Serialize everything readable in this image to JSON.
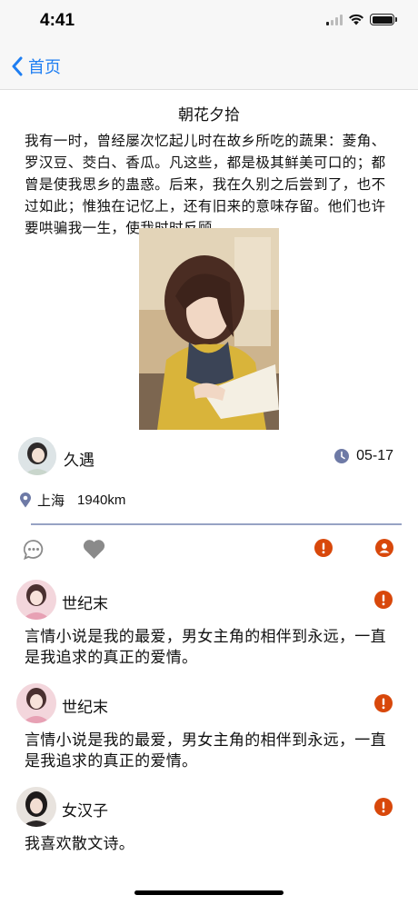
{
  "status_bar": {
    "time": "4:41"
  },
  "nav": {
    "back_label": "首页"
  },
  "article": {
    "title": "朝花夕拾",
    "body": "我有一时，曾经屡次忆起儿时在故乡所吃的蔬果：菱角、罗汉豆、茭白、香瓜。凡这些，都是极其鲜美可口的；都曾是使我思乡的蛊惑。后来，我在久别之后尝到了，也不过如此；惟独在记忆上，还有旧来的意味存留。他们也许要哄骗我一生，使我时时反顾。"
  },
  "author": {
    "name": "久遇",
    "date": "05-17"
  },
  "location": {
    "city": "上海",
    "distance": "1940km"
  },
  "colors": {
    "accent": "#1e7ef2",
    "report": "#d8480b",
    "divider": "#97a3c4",
    "icon_gray": "#8a8a8a"
  },
  "comments": [
    {
      "name": "世纪末",
      "text": "言情小说是我的最爱，男女主角的相伴到永远，一直是我追求的真正的爱情。"
    },
    {
      "name": "世纪末",
      "text": "言情小说是我的最爱，男女主角的相伴到永远，一直是我追求的真正的爱情。"
    },
    {
      "name": "女汉子",
      "text": "我喜欢散文诗。"
    }
  ]
}
